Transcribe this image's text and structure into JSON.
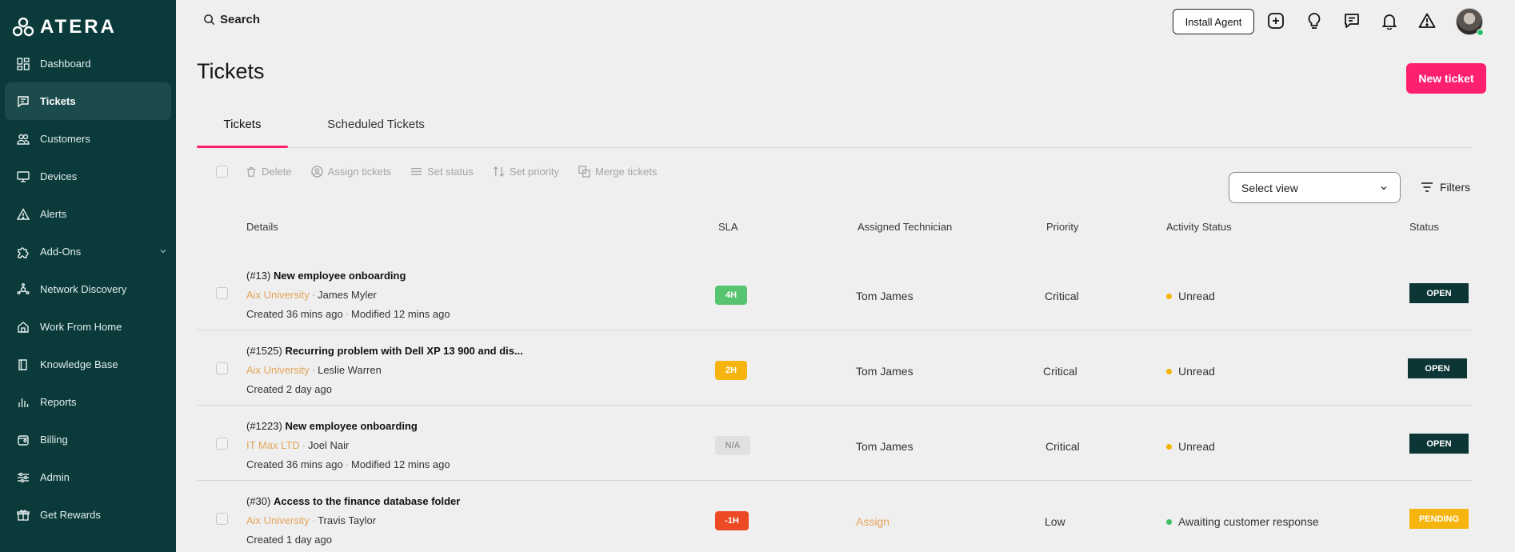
{
  "brand": {
    "logo_text": "ATERA"
  },
  "sidebar": {
    "items": [
      {
        "label": "Dashboard",
        "icon": "dashboard-icon"
      },
      {
        "label": "Tickets",
        "icon": "tickets-icon",
        "active": true
      },
      {
        "label": "Customers",
        "icon": "customers-icon"
      },
      {
        "label": "Devices",
        "icon": "devices-icon"
      },
      {
        "label": "Alerts",
        "icon": "alert-icon"
      },
      {
        "label": "Add-Ons",
        "icon": "puzzle-icon",
        "has_chevron": true
      },
      {
        "label": "Network Discovery",
        "icon": "network-icon"
      },
      {
        "label": "Work From Home",
        "icon": "home-icon"
      },
      {
        "label": "Knowledge Base",
        "icon": "book-icon"
      },
      {
        "label": "Reports",
        "icon": "reports-icon"
      },
      {
        "label": "Billing",
        "icon": "billing-icon"
      },
      {
        "label": "Admin",
        "icon": "sliders-icon"
      },
      {
        "label": "Get Rewards",
        "icon": "gift-icon"
      }
    ]
  },
  "topbar": {
    "search_label": "Search",
    "install_agent": "Install Agent",
    "icons": [
      "plus-square-icon",
      "lightbulb-icon",
      "chat-icon",
      "bell-icon",
      "warning-icon"
    ]
  },
  "page": {
    "title": "Tickets",
    "new_ticket": "New ticket"
  },
  "tabs": [
    {
      "label": "Tickets",
      "active": true
    },
    {
      "label": "Scheduled Tickets"
    }
  ],
  "actions": {
    "delete": "Delete",
    "assign": "Assign tickets",
    "set_status": "Set status",
    "set_priority": "Set priority",
    "merge": "Merge tickets",
    "select_view": "Select view",
    "filters": "Filters"
  },
  "table": {
    "headers": {
      "details": "Details",
      "sla": "SLA",
      "tech": "Assigned Technician",
      "priority": "Priority",
      "activity": "Activity Status",
      "status": "Status"
    },
    "rows": [
      {
        "num": "(#13)",
        "title": "New employee onboarding",
        "customer": "Aix University",
        "contact": "James Myler",
        "created": "Created 36 mins ago",
        "modified": "Modified 12 mins ago",
        "sla": "4H",
        "sla_color": "#57c46f",
        "sla_text_color": "#ffffff",
        "tech": "Tom James",
        "priority": "Critical",
        "activity": "Unread",
        "activity_color": "#f5b400",
        "status": "OPEN",
        "status_color": "#0c3535"
      },
      {
        "num": "(#1525)",
        "title": "Recurring problem with Dell XP 13 900 and dis...",
        "customer": "Aix University",
        "contact": "Leslie Warren",
        "created": "Created 2 day ago",
        "modified": "",
        "sla": "2H",
        "sla_color": "#f6b40e",
        "sla_text_color": "#ffffff",
        "tech": "Tom James",
        "priority": "Critical",
        "activity": "Unread",
        "activity_color": "#f5b400",
        "status": "OPEN",
        "status_color": "#0c3535"
      },
      {
        "num": "(#1223)",
        "title": "New employee onboarding",
        "customer": "IT Max LTD",
        "contact": "Joel Nair",
        "created": "Created 36 mins ago",
        "modified": "Modified 12 mins ago",
        "sla": "N/A",
        "sla_color": "#e0e0e0",
        "sla_text_color": "#9a9a9a",
        "tech": "Tom James",
        "priority": "Critical",
        "activity": "Unread",
        "activity_color": "#f5b400",
        "status": "OPEN",
        "status_color": "#0c3535"
      },
      {
        "num": "(#30)",
        "title": "Access to the finance database folder",
        "customer": "Aix University",
        "contact": "Travis Taylor",
        "created": "Created 1 day ago",
        "modified": "",
        "sla": "-1H",
        "sla_color": "#ec4a24",
        "sla_text_color": "#ffffff",
        "tech": "Assign",
        "priority": "Low",
        "activity": "Awaiting customer response",
        "activity_color": "#3fbf63",
        "status": "PENDING",
        "status_color": "#f6b40e"
      }
    ]
  }
}
